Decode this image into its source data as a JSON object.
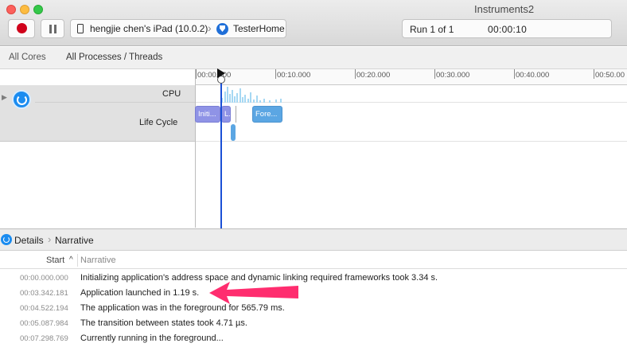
{
  "window": {
    "title": "Instruments2"
  },
  "toolbar": {
    "device_label": "hengjie chen's iPad (10.0.2)",
    "app_label": "TesterHome",
    "run_label": "Run 1 of 1",
    "run_time": "00:00:10"
  },
  "scope": {
    "cores": "All Cores",
    "processes": "All Processes / Threads"
  },
  "ruler": {
    "ticks": [
      "00:00.000",
      "00:10.000",
      "00:20.000",
      "00:30.000",
      "00:40.000",
      "00:50.00"
    ]
  },
  "tracks": {
    "cpu_label": "CPU",
    "lifecycle_label": "Life Cycle",
    "segments": [
      {
        "label": "Initi...",
        "color": "#8f93e6"
      },
      {
        "label": "L...",
        "color": "#8f93e6"
      },
      {
        "label": "Fore...",
        "color": "#5ba6e3"
      }
    ]
  },
  "details": {
    "label": "Details",
    "narrative_label": "Narrative",
    "columns": {
      "start": "Start",
      "narrative": "Narrative"
    },
    "rows": [
      {
        "time": "00:00.000.000",
        "text": "Initializing application's address space and dynamic linking required frameworks took 3.34 s."
      },
      {
        "time": "00:03.342.181",
        "text": "Application launched in 1.19 s."
      },
      {
        "time": "00:04.522.194",
        "text": "The application was in the foreground for 565.79 ms."
      },
      {
        "time": "00:05.087.984",
        "text": "The transition between states took 4.71 µs."
      },
      {
        "time": "00:07.298.769",
        "text": "Currently running in the foreground..."
      }
    ]
  },
  "colors": {
    "record": "#d0021b",
    "playhead": "#1a4fd6",
    "annotation_arrow": "#ff2d6f"
  }
}
